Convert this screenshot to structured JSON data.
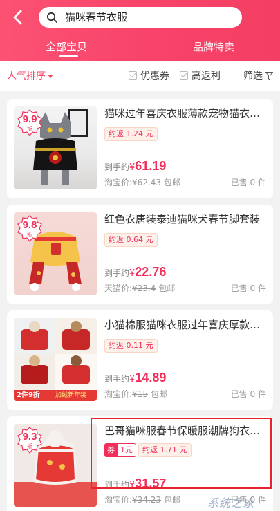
{
  "search": {
    "query": "猫咪春节衣服"
  },
  "tabs": [
    {
      "label": "全部宝贝",
      "active": true
    },
    {
      "label": "品牌特卖",
      "active": false
    }
  ],
  "filters": {
    "sort_label": "人气排序",
    "checkbox1": "优惠券",
    "checkbox2": "高返利",
    "screen_label": "筛选"
  },
  "products": [
    {
      "badge_num": "9.9",
      "badge_unit": "折",
      "title": "猫咪过年喜庆衣服薄款宠物猫衣服冬季",
      "rebate": "约返 1.24 元",
      "price_label": "到手约",
      "currency": "¥",
      "price": "61.19",
      "source_label": "淘宝价:",
      "orig_price": "¥62.43",
      "shipping": "包邮",
      "sold": "已售 0 件"
    },
    {
      "badge_num": "9.8",
      "badge_unit": "折",
      "title": "红色衣唐装泰迪猫咪犬春节脚套装",
      "rebate": "约返 0.64 元",
      "price_label": "到手约",
      "currency": "¥",
      "price": "22.76",
      "source_label": "天猫价:",
      "orig_price": "¥23.4",
      "shipping": "包邮",
      "sold": "已售 0 件"
    },
    {
      "title": "小猫棉服猫咪衣服过年喜庆厚款冬季",
      "rebate": "约返 0.11 元",
      "price_label": "到手约",
      "currency": "¥",
      "price": "14.89",
      "source_label": "淘宝价:",
      "orig_price": "¥15",
      "shipping": "包邮",
      "sold": "已售 0 件",
      "promo_left": "2件9折",
      "promo_right": "加绒新年装"
    },
    {
      "badge_num": "9.3",
      "badge_unit": "折",
      "title": "巴哥猫咪服春节保暖服潮牌狗衣服冬",
      "coupon_label": "券",
      "coupon_value": "1元",
      "rebate": "约返 1.71 元",
      "price_label": "到手约",
      "currency": "¥",
      "price": "31.57",
      "source_label": "淘宝价:",
      "orig_price": "¥34.23",
      "shipping": "包邮",
      "sold": "已售 0 件"
    }
  ],
  "watermark": "系统之家",
  "colors": {
    "accent": "#f0305a",
    "header": "#f8436a"
  }
}
